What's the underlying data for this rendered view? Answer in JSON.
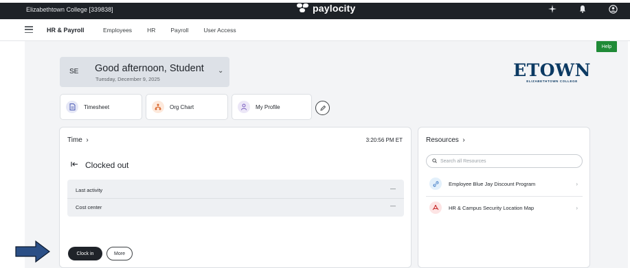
{
  "topbar": {
    "company": "Elizabethtown College [339838]",
    "logo_text": "paylocity",
    "icons": [
      "sparkle-icon",
      "bell-icon",
      "user-circle-icon"
    ]
  },
  "nav": {
    "title": "HR & Payroll",
    "items": [
      "Employees",
      "HR",
      "Payroll",
      "User Access"
    ]
  },
  "help_label": "Help",
  "greeting": {
    "initials": "SE",
    "text": "Good afternoon, Student",
    "date": "Tuesday, December 9, 2025"
  },
  "brand": {
    "name": "ETOWN",
    "sub": "ELIZABETHTOWN COLLEGE",
    "color": "#0c3a63"
  },
  "quick_links": [
    {
      "label": "Timesheet",
      "icon": "document-icon",
      "bg": "#e5e7f6",
      "fg": "#4b5bb5"
    },
    {
      "label": "Org Chart",
      "icon": "org-chart-icon",
      "bg": "#fde9dc",
      "fg": "#d9652b"
    },
    {
      "label": "My Profile",
      "icon": "person-icon",
      "bg": "#ece7f7",
      "fg": "#7a5dc0"
    }
  ],
  "time_card": {
    "title": "Time",
    "clock": "3:20:56 PM ET",
    "status": "Clocked out",
    "rows": [
      {
        "label": "Last activity",
        "value": "—"
      },
      {
        "label": "Cost center",
        "value": "—"
      }
    ],
    "clock_in_label": "Clock in",
    "more_label": "More"
  },
  "resources": {
    "title": "Resources",
    "search_placeholder": "Search all Resources",
    "items": [
      {
        "label": "Employee Blue Jay Discount Program",
        "icon": "link-icon",
        "bg": "#e3f0fb",
        "fg": "#2f6fc0"
      },
      {
        "label": "HR & Campus Security Location Map",
        "icon": "pdf-icon",
        "bg": "#fde4e4",
        "fg": "#c62828"
      }
    ]
  },
  "colors": {
    "topbar": "#1e2227",
    "help": "#1f8a37",
    "arrow": "#2b4f86"
  }
}
